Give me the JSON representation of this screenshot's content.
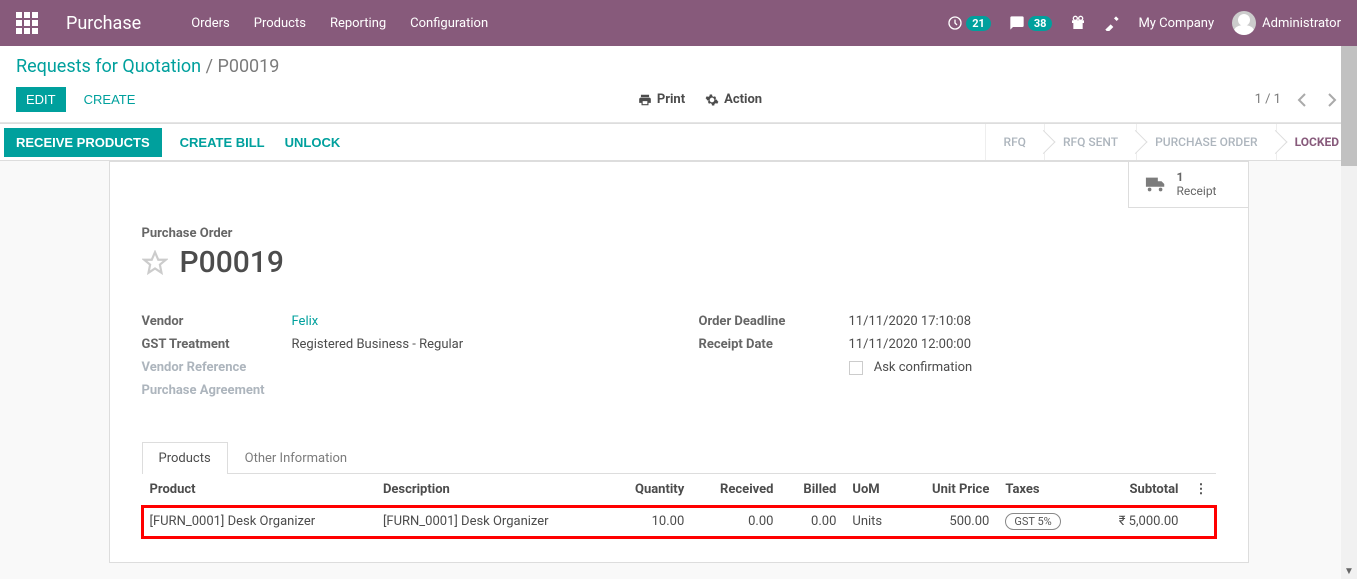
{
  "navbar": {
    "brand": "Purchase",
    "menu": [
      "Orders",
      "Products",
      "Reporting",
      "Configuration"
    ],
    "clock_badge": "21",
    "chat_badge": "38",
    "company": "My Company",
    "user": "Administrator"
  },
  "breadcrumb": {
    "parent": "Requests for Quotation",
    "sep": "/",
    "current": "P00019"
  },
  "controls": {
    "edit": "EDIT",
    "create": "CREATE",
    "print": "Print",
    "action": "Action",
    "pager": "1 / 1"
  },
  "status": {
    "receive": "RECEIVE PRODUCTS",
    "create_bill": "CREATE BILL",
    "unlock": "UNLOCK",
    "steps": [
      "RFQ",
      "RFQ SENT",
      "PURCHASE ORDER",
      "LOCKED"
    ],
    "active_step_index": 3
  },
  "stat": {
    "receipt_count": "1",
    "receipt_label": "Receipt"
  },
  "form": {
    "title_label": "Purchase Order",
    "title": "P00019",
    "left": {
      "vendor_label": "Vendor",
      "vendor_value": "Felix",
      "gst_label": "GST Treatment",
      "gst_value": "Registered Business - Regular",
      "vendor_ref_label": "Vendor Reference",
      "agreement_label": "Purchase Agreement"
    },
    "right": {
      "deadline_label": "Order Deadline",
      "deadline_value": "11/11/2020 17:10:08",
      "receipt_label": "Receipt Date",
      "receipt_value": "11/11/2020 12:00:00",
      "ask_label": "Ask confirmation"
    }
  },
  "tabs": {
    "products": "Products",
    "other": "Other Information"
  },
  "table": {
    "headers": {
      "product": "Product",
      "description": "Description",
      "quantity": "Quantity",
      "received": "Received",
      "billed": "Billed",
      "uom": "UoM",
      "unit_price": "Unit Price",
      "taxes": "Taxes",
      "subtotal": "Subtotal"
    },
    "rows": [
      {
        "product": "[FURN_0001] Desk Organizer",
        "description": "[FURN_0001] Desk Organizer",
        "quantity": "10.00",
        "received": "0.00",
        "billed": "0.00",
        "uom": "Units",
        "unit_price": "500.00",
        "taxes": "GST 5%",
        "subtotal": "₹ 5,000.00"
      }
    ]
  }
}
